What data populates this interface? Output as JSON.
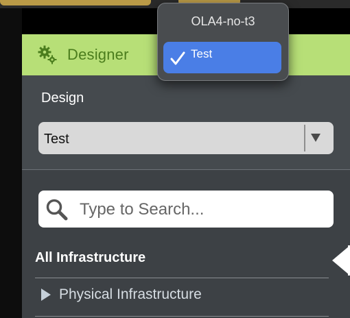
{
  "header": {
    "title": "Designer",
    "icon": "gears-icon",
    "accent": "#b7df77"
  },
  "design": {
    "label": "Design",
    "selected": "Test"
  },
  "dropdown": {
    "options": [
      {
        "label": "OLA4-no-t3",
        "selected": false
      },
      {
        "label": "Test",
        "selected": true
      }
    ]
  },
  "search": {
    "placeholder": "Type to Search...",
    "value": ""
  },
  "tree": {
    "heading": "All Infrastructure",
    "items": [
      {
        "label": "Physical Infrastructure",
        "expanded": false
      }
    ]
  },
  "colors": {
    "panel": "#454a4e",
    "selection": "#4a7ee6"
  }
}
